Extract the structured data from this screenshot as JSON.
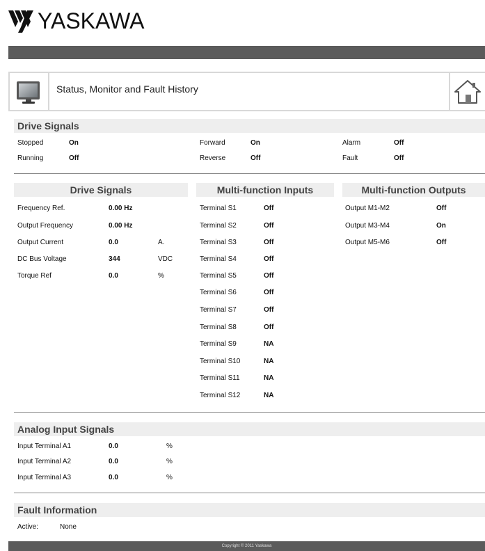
{
  "brand": {
    "name": "YASKAWA"
  },
  "header": {
    "title": "Status, Monitor and Fault History",
    "left_icon": "monitor-icon",
    "right_icon": "home-icon"
  },
  "drive_status": {
    "title": "Drive Signals",
    "items": [
      {
        "label": "Stopped",
        "value": "On"
      },
      {
        "label": "Running",
        "value": "Off"
      },
      {
        "label": "Forward",
        "value": "On"
      },
      {
        "label": "Reverse",
        "value": "Off"
      },
      {
        "label": "Alarm",
        "value": "Off"
      },
      {
        "label": "Fault",
        "value": "Off"
      }
    ]
  },
  "drive_signals": {
    "title": "Drive Signals",
    "rows": [
      {
        "label": "Frequency Ref.",
        "value": "0.00 Hz",
        "unit": ""
      },
      {
        "label": "Output Frequency",
        "value": "0.00 Hz",
        "unit": ""
      },
      {
        "label": "Output Current",
        "value": "0.0",
        "unit": "A."
      },
      {
        "label": "DC Bus Voltage",
        "value": "344",
        "unit": "VDC"
      },
      {
        "label": "Torque Ref",
        "value": "0.0",
        "unit": "%"
      }
    ]
  },
  "inputs": {
    "title": "Multi-function Inputs",
    "rows": [
      {
        "label": "Terminal S1",
        "value": "Off"
      },
      {
        "label": "Terminal S2",
        "value": "Off"
      },
      {
        "label": "Terminal S3",
        "value": "Off"
      },
      {
        "label": "Terminal S4",
        "value": "Off"
      },
      {
        "label": "Terminal S5",
        "value": "Off"
      },
      {
        "label": "Terminal S6",
        "value": "Off"
      },
      {
        "label": "Terminal S7",
        "value": "Off"
      },
      {
        "label": "Terminal S8",
        "value": "Off"
      },
      {
        "label": "Terminal S9",
        "value": "NA"
      },
      {
        "label": "Terminal S10",
        "value": "NA"
      },
      {
        "label": "Terminal S11",
        "value": "NA"
      },
      {
        "label": "Terminal S12",
        "value": "NA"
      }
    ]
  },
  "outputs": {
    "title": "Multi-function Outputs",
    "rows": [
      {
        "label": "Output M1-M2",
        "value": "Off"
      },
      {
        "label": "Output M3-M4",
        "value": "On"
      },
      {
        "label": "Output M5-M6",
        "value": "Off"
      }
    ]
  },
  "analog": {
    "title": "Analog Input Signals",
    "rows": [
      {
        "label": "Input Terminal A1",
        "value": "0.0",
        "unit": "%"
      },
      {
        "label": "Input Terminal A2",
        "value": "0.0",
        "unit": "%"
      },
      {
        "label": "Input Terminal A3",
        "value": "0.0",
        "unit": "%"
      }
    ]
  },
  "fault": {
    "title": "Fault Information",
    "label": "Active:",
    "value": "None"
  },
  "footer": {
    "text": "Copyright © 2011 Yaskawa"
  },
  "colors": {
    "bar": "#5b5b5b",
    "band": "#eeeeee",
    "border": "#d8d8d8"
  }
}
